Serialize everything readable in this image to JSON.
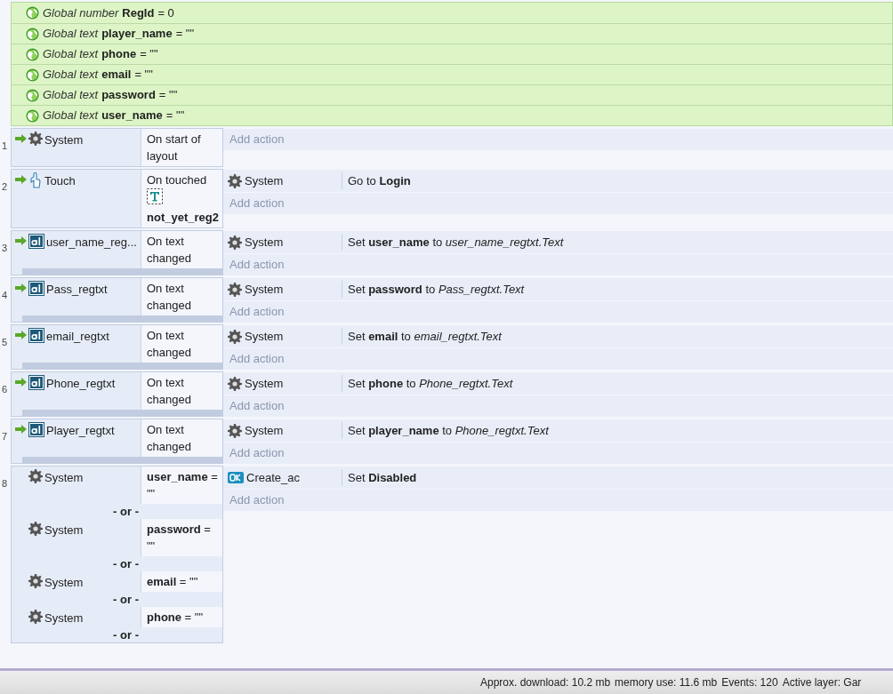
{
  "globals": [
    {
      "type_label": "Global number",
      "name": "RegId",
      "value": "= 0"
    },
    {
      "type_label": "Global text",
      "name": "player_name",
      "value": "= \"\""
    },
    {
      "type_label": "Global text",
      "name": "phone",
      "value": "= \"\""
    },
    {
      "type_label": "Global text",
      "name": "email",
      "value": "= \"\""
    },
    {
      "type_label": "Global text",
      "name": "password",
      "value": "= \"\""
    },
    {
      "type_label": "Global text",
      "name": "user_name",
      "value": "= \"\""
    }
  ],
  "events": [
    {
      "number": "1",
      "trigger": true,
      "sub_event_bar": false,
      "conditions": [
        {
          "object": "System",
          "kind": "system",
          "text": "On start of layout"
        }
      ],
      "add_action": "Add action"
    },
    {
      "number": "2",
      "trigger": true,
      "sub_event_bar": false,
      "conditions": [
        {
          "object": "Touch",
          "kind": "touch",
          "text": "On touched",
          "param": "not_yet_reg2"
        }
      ],
      "actions": [
        {
          "object": "System",
          "kind": "system",
          "text": "Go to **Login**"
        }
      ],
      "add_action": "Add action"
    },
    {
      "number": "3",
      "trigger": true,
      "sub_event_bar": true,
      "conditions": [
        {
          "object": "user_name_reg...",
          "kind": "textbox",
          "text": "On text changed"
        }
      ],
      "actions": [
        {
          "object": "System",
          "kind": "system",
          "text": "Set **user_name** to *user_name_regtxt.Text*"
        }
      ],
      "add_action": "Add action"
    },
    {
      "number": "4",
      "trigger": true,
      "sub_event_bar": true,
      "conditions": [
        {
          "object": "Pass_regtxt",
          "kind": "textbox",
          "text": "On text changed"
        }
      ],
      "actions": [
        {
          "object": "System",
          "kind": "system",
          "text": "Set **password** to *Pass_regtxt.Text*"
        }
      ],
      "add_action": "Add action"
    },
    {
      "number": "5",
      "trigger": true,
      "sub_event_bar": true,
      "conditions": [
        {
          "object": "email_regtxt",
          "kind": "textbox",
          "text": "On text changed"
        }
      ],
      "actions": [
        {
          "object": "System",
          "kind": "system",
          "text": "Set **email** to *email_regtxt.Text*"
        }
      ],
      "add_action": "Add action"
    },
    {
      "number": "6",
      "trigger": true,
      "sub_event_bar": true,
      "conditions": [
        {
          "object": "Phone_regtxt",
          "kind": "textbox",
          "text": "On text changed"
        }
      ],
      "actions": [
        {
          "object": "System",
          "kind": "system",
          "text": "Set **phone** to *Phone_regtxt.Text*"
        }
      ],
      "add_action": "Add action"
    },
    {
      "number": "7",
      "trigger": true,
      "sub_event_bar": true,
      "conditions": [
        {
          "object": "Player_regtxt",
          "kind": "textbox",
          "text": "On text changed"
        }
      ],
      "actions": [
        {
          "object": "System",
          "kind": "system",
          "text": "Set **player_name** to *Phone_regtxt.Text*"
        }
      ],
      "add_action": "Add action"
    },
    {
      "number": "8",
      "trigger": false,
      "sub_event_bar": false,
      "conditions": [
        {
          "object": "System",
          "kind": "system",
          "text": "**user_name** = \"\""
        },
        {
          "separator": "- or -",
          "object": "System",
          "kind": "system",
          "text": "**password** = \"\""
        },
        {
          "separator": "- or -",
          "object": "System",
          "kind": "system",
          "text": "**email** = \"\""
        },
        {
          "separator": "- or -",
          "object": "System",
          "kind": "system",
          "text": "**phone** = \"\""
        },
        {
          "separator": "- or -"
        }
      ],
      "actions": [
        {
          "object": "Create_ac",
          "kind": "button",
          "text": "Set **Disabled**"
        }
      ],
      "add_action": "Add action"
    }
  ],
  "status_bar": [
    "Approx. download: 10.2 mb",
    "memory use: 11.6 mb",
    "Events: 120",
    "Active layer: Gar"
  ]
}
